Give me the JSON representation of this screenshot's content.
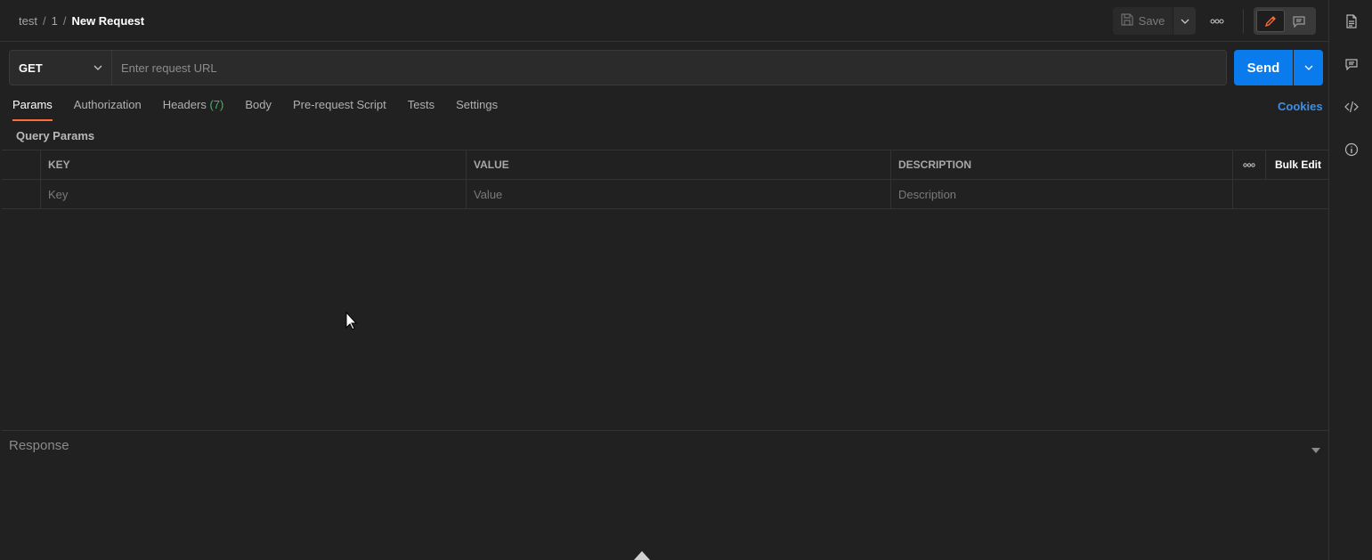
{
  "breadcrumb": {
    "parts": [
      "test",
      "1"
    ],
    "separator": "/",
    "current": "New Request"
  },
  "toolbar": {
    "save_label": "Save",
    "save_icon": "save-icon",
    "more_icon": "more-horizontal-icon",
    "mode_edit_icon": "pencil-icon",
    "mode_comment_icon": "comment-icon"
  },
  "request": {
    "method": "GET",
    "url_placeholder": "Enter request URL",
    "url_value": "",
    "send_label": "Send"
  },
  "tabs": [
    {
      "label": "Params",
      "active": true
    },
    {
      "label": "Authorization"
    },
    {
      "label": "Headers",
      "count": "(7)"
    },
    {
      "label": "Body"
    },
    {
      "label": "Pre-request Script"
    },
    {
      "label": "Tests"
    },
    {
      "label": "Settings"
    }
  ],
  "cookies_label": "Cookies",
  "query_params": {
    "title": "Query Params",
    "headers": {
      "key": "KEY",
      "value": "VALUE",
      "description": "DESCRIPTION",
      "bulk_edit": "Bulk Edit"
    },
    "placeholders": {
      "key": "Key",
      "value": "Value",
      "description": "Description"
    }
  },
  "response": {
    "title": "Response"
  },
  "right_sidebar": [
    "documentation-icon",
    "comments-icon",
    "code-icon",
    "info-icon"
  ],
  "colors": {
    "accent_tab": "#ff6c37",
    "send": "#097bed",
    "count": "#3fb86b",
    "link": "#3d8fe6"
  }
}
